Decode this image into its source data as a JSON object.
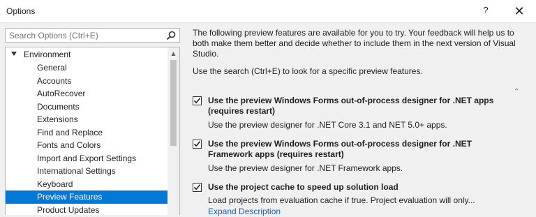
{
  "window": {
    "title": "Options",
    "help_label": "?",
    "close_label": "✕"
  },
  "search": {
    "placeholder": "Search Options (Ctrl+E)",
    "value": ""
  },
  "tree": {
    "root_label": "Environment",
    "items": [
      {
        "label": "General"
      },
      {
        "label": "Accounts"
      },
      {
        "label": "AutoRecover"
      },
      {
        "label": "Documents"
      },
      {
        "label": "Extensions"
      },
      {
        "label": "Find and Replace"
      },
      {
        "label": "Fonts and Colors"
      },
      {
        "label": "Import and Export Settings"
      },
      {
        "label": "International Settings"
      },
      {
        "label": "Keyboard"
      },
      {
        "label": "Preview Features",
        "selected": true
      },
      {
        "label": "Product Updates"
      }
    ]
  },
  "content": {
    "intro": "The following preview features are available for you to try. Your feedback will help us to both make them better and decide whether to include them in the next version of Visual Studio.",
    "search_hint": "Use the search (Ctrl+E) to look for a specific preview features.",
    "features": [
      {
        "title": "Use the preview Windows Forms out-of-process designer for .NET apps (requires restart)",
        "description": "Use the preview designer for .NET Core 3.1 and NET 5.0+ apps.",
        "checked": true
      },
      {
        "title": "Use the preview Windows Forms out-of-process designer for .NET Framework apps (requires restart)",
        "description": "Use the preview designer for .NET Framework apps.",
        "checked": true
      },
      {
        "title": "Use the project cache to speed up solution load",
        "description": "Load projects from evaluation cache if true. Project evaluation will only...",
        "link": "Expand Description",
        "checked": true
      }
    ]
  },
  "icons": {
    "search": "search-icon",
    "expander": "expander-down-icon",
    "check": "checkmark-icon",
    "scroll_up": "chevron-up-icon"
  },
  "colors": {
    "selection": "#0078d7",
    "link": "#1a5fb4"
  }
}
